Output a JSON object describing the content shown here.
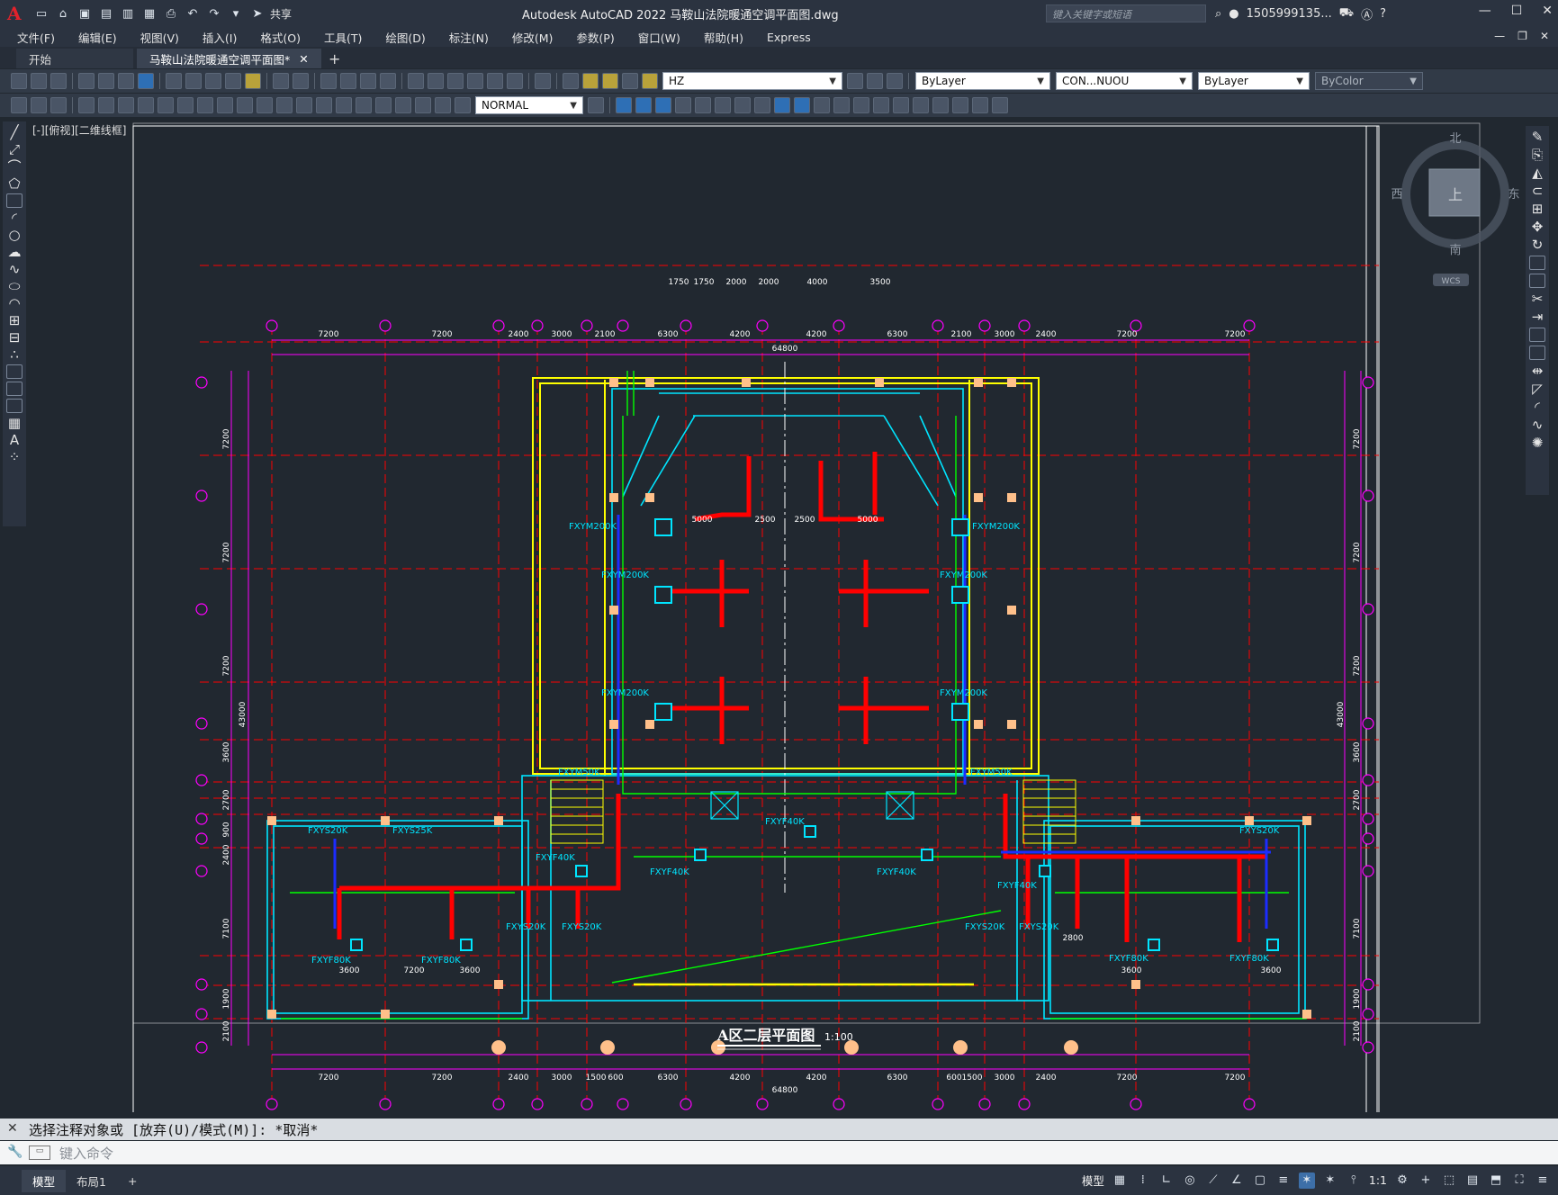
{
  "app": {
    "title": "Autodesk AutoCAD 2022    马鞍山法院暖通空调平面图.dwg",
    "search_placeholder": "键入关键字或短语",
    "user": "1505999135...",
    "share_label": "共享"
  },
  "menu": {
    "items": [
      "文件(F)",
      "编辑(E)",
      "视图(V)",
      "插入(I)",
      "格式(O)",
      "工具(T)",
      "绘图(D)",
      "标注(N)",
      "修改(M)",
      "参数(P)",
      "窗口(W)",
      "帮助(H)",
      "Express"
    ]
  },
  "tabs": [
    {
      "label": "开始"
    },
    {
      "label": "马鞍山法院暖通空调平面图*"
    }
  ],
  "toolbar": {
    "layer_combo": "HZ",
    "color_combo": "ByLayer",
    "linetype_combo": "CON...NUOU",
    "lineweight_combo": "ByLayer",
    "plotstyle_combo": "ByColor",
    "dimstyle_combo": "NORMAL"
  },
  "viewport": {
    "label": "[-][俯视][二维线框]"
  },
  "viewcube": {
    "north": "北",
    "south": "南",
    "east": "东",
    "west": "西",
    "top": "上",
    "wcs": "WCS"
  },
  "drawing": {
    "title_big": "A区二层平面图",
    "scale": "1:100",
    "overall_dim": "64800",
    "top_dims": [
      "7200",
      "7200",
      "2400",
      "3000",
      "2100",
      "6300",
      "4200",
      "4200",
      "6300",
      "2100",
      "3000",
      "2400",
      "7200",
      "7200"
    ],
    "bottom_dims": [
      "7200",
      "7200",
      "2400",
      "3000",
      "1500",
      "600",
      "6300",
      "4200",
      "4200",
      "6300",
      "600",
      "1500",
      "3000",
      "2400",
      "7200",
      "7200"
    ],
    "left_dims": [
      "7200",
      "7200",
      "7200",
      "3600",
      "2700",
      "900",
      "2400",
      "7100",
      "1900",
      "2100"
    ],
    "side_total": "43000",
    "hall_dims_top": [
      "1750",
      "1750",
      "2000",
      "2000",
      "4000",
      "3500"
    ],
    "hall_dims_mid": [
      "5000",
      "2500",
      "2500",
      "5000"
    ],
    "units": [
      "FXYM200K",
      "FXYM200K",
      "FXYM200K",
      "FXYM200K",
      "FXYM200K",
      "FXYM200K",
      "FXYM50K",
      "FXYM50K",
      "FXYS20K",
      "FXYS25K",
      "FXYS20K",
      "FXYS20K",
      "FXYS20K",
      "FXYS20K",
      "FXYS20K",
      "FXYF40K",
      "FXYF40K",
      "FXYF40K",
      "FXYF40K",
      "FXYF40K",
      "FXYF80K",
      "FXYF80K",
      "FXYF80K",
      "FXYF80K"
    ],
    "small_dims": [
      "3600",
      "7200",
      "3600",
      "2800",
      "3600",
      "3600"
    ]
  },
  "command": {
    "history": "选择注释对象或 [放弃(U)/模式(M)]: *取消*",
    "placeholder": "键入命令"
  },
  "status": {
    "model_tab": "模型",
    "layout_tab": "布局1",
    "model_label": "模型",
    "scale": "1:1"
  },
  "colors": {
    "background": "#212830",
    "axis": "#ff00ff",
    "grid_red": "#ff0000",
    "duct": "#ff0000",
    "wall_cyan": "#00e5ff",
    "wall_yellow": "#ffff00",
    "pipe_green": "#00ff00",
    "pipe_blue": "#1c2cff",
    "column": "#ffc08a"
  }
}
